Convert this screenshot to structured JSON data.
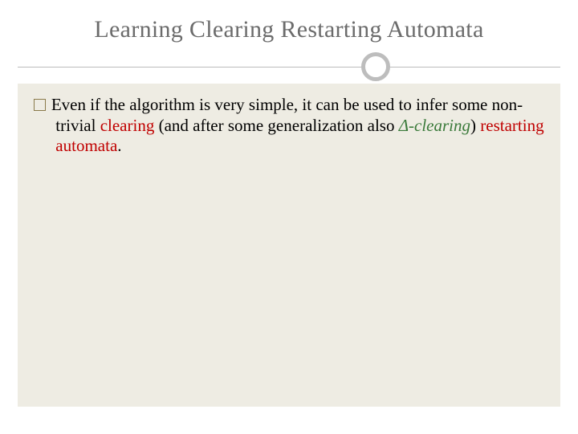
{
  "slide": {
    "title": "Learning Clearing Restarting Automata",
    "bullet": {
      "t1": "Even if the algorithm is very simple, it can be used to infer some non-trivial ",
      "clearing": "clearing",
      "t2": " (and after some generalization also ",
      "delta_clearing": "Δ-clearing",
      "t3": ") ",
      "restarting_automata": "restarting automata",
      "t4": "."
    }
  }
}
